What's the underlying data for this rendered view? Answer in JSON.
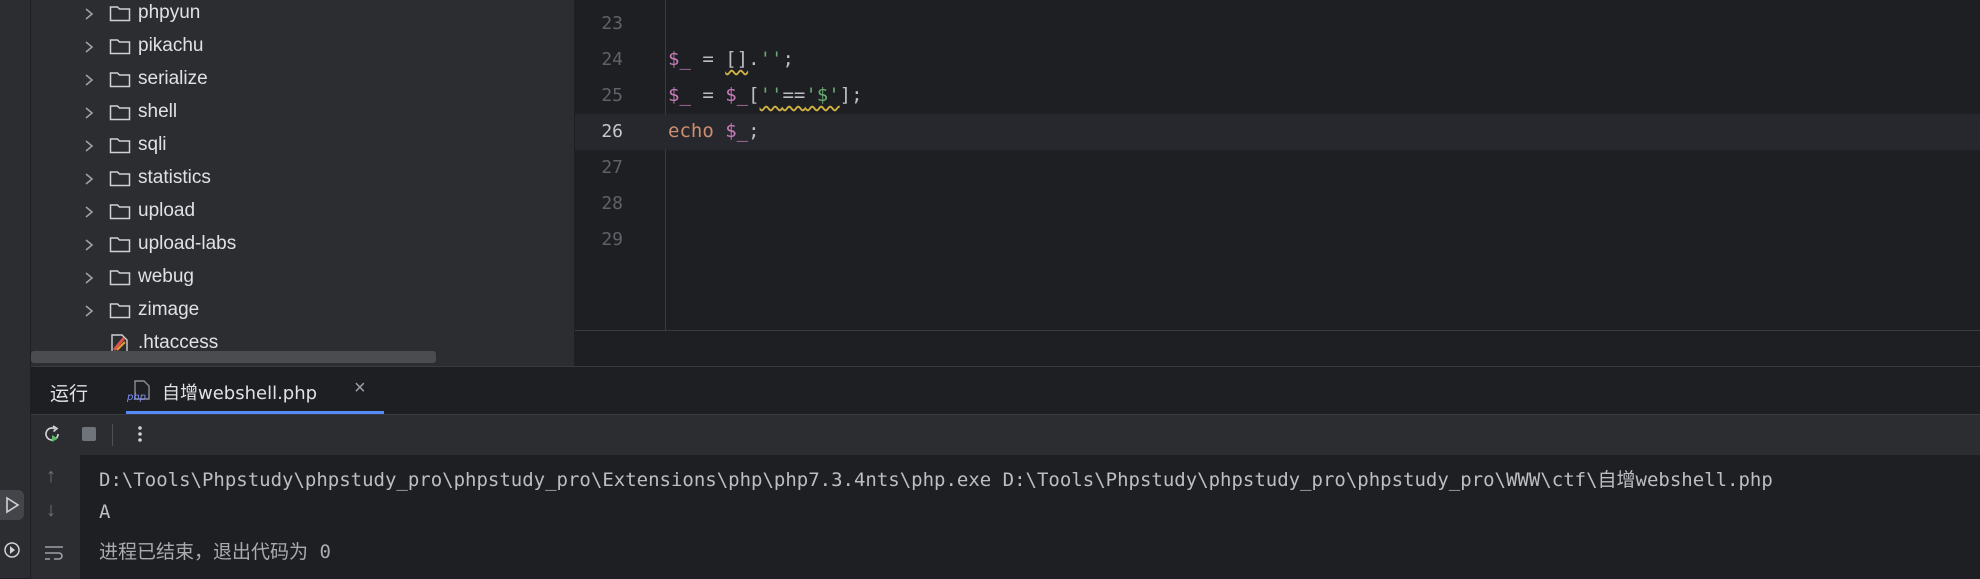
{
  "project_tree": {
    "items": [
      {
        "label": "phpyun",
        "type": "folder"
      },
      {
        "label": "pikachu",
        "type": "folder"
      },
      {
        "label": "serialize",
        "type": "folder"
      },
      {
        "label": "shell",
        "type": "folder"
      },
      {
        "label": "sqli",
        "type": "folder"
      },
      {
        "label": "statistics",
        "type": "folder"
      },
      {
        "label": "upload",
        "type": "folder"
      },
      {
        "label": "upload-labs",
        "type": "folder"
      },
      {
        "label": "webug",
        "type": "folder"
      },
      {
        "label": "zimage",
        "type": "folder"
      },
      {
        "label": ".htaccess",
        "type": "file"
      }
    ]
  },
  "editor": {
    "current_line": 26,
    "lines": [
      {
        "number": "23",
        "text": ""
      },
      {
        "number": "24",
        "text": "$_ = [].'';"
      },
      {
        "number": "25",
        "text": "$_ = $_[''=='$'];"
      },
      {
        "number": "26",
        "text": "echo $_;"
      },
      {
        "number": "27",
        "text": ""
      },
      {
        "number": "28",
        "text": ""
      },
      {
        "number": "29",
        "text": ""
      }
    ]
  },
  "run_panel": {
    "title": "运行",
    "tab_label": "自增webshell.php",
    "tab_icon": "php-icon",
    "toolbar": [
      "rerun-icon",
      "stop-icon",
      "more-icon"
    ],
    "console": {
      "command": "D:\\Tools\\Phpstudy\\phpstudy_pro\\phpstudy_pro\\Extensions\\php\\php7.3.4nts\\php.exe D:\\Tools\\Phpstudy\\phpstudy_pro\\phpstudy_pro\\WWW\\ctf\\自增webshell.php",
      "output": "A",
      "exit_message": "进程已结束，退出代码为 0"
    }
  },
  "colors": {
    "background": "#1e1f22",
    "panel": "#2b2d30",
    "variable": "#c77dbb",
    "string": "#6aab73",
    "keyword": "#cf8e6d",
    "accent": "#548af7"
  }
}
